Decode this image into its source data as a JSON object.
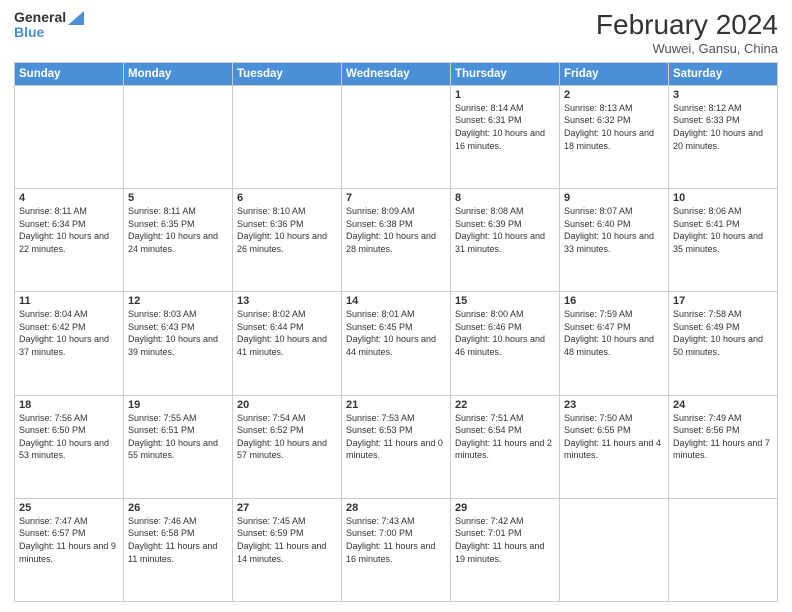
{
  "header": {
    "logo_line1": "General",
    "logo_line2": "Blue",
    "title": "February 2024",
    "subtitle": "Wuwei, Gansu, China"
  },
  "days_of_week": [
    "Sunday",
    "Monday",
    "Tuesday",
    "Wednesday",
    "Thursday",
    "Friday",
    "Saturday"
  ],
  "weeks": [
    [
      {
        "day": "",
        "info": ""
      },
      {
        "day": "",
        "info": ""
      },
      {
        "day": "",
        "info": ""
      },
      {
        "day": "",
        "info": ""
      },
      {
        "day": "1",
        "info": "Sunrise: 8:14 AM\nSunset: 6:31 PM\nDaylight: 10 hours and 16 minutes."
      },
      {
        "day": "2",
        "info": "Sunrise: 8:13 AM\nSunset: 6:32 PM\nDaylight: 10 hours and 18 minutes."
      },
      {
        "day": "3",
        "info": "Sunrise: 8:12 AM\nSunset: 6:33 PM\nDaylight: 10 hours and 20 minutes."
      }
    ],
    [
      {
        "day": "4",
        "info": "Sunrise: 8:11 AM\nSunset: 6:34 PM\nDaylight: 10 hours and 22 minutes."
      },
      {
        "day": "5",
        "info": "Sunrise: 8:11 AM\nSunset: 6:35 PM\nDaylight: 10 hours and 24 minutes."
      },
      {
        "day": "6",
        "info": "Sunrise: 8:10 AM\nSunset: 6:36 PM\nDaylight: 10 hours and 26 minutes."
      },
      {
        "day": "7",
        "info": "Sunrise: 8:09 AM\nSunset: 6:38 PM\nDaylight: 10 hours and 28 minutes."
      },
      {
        "day": "8",
        "info": "Sunrise: 8:08 AM\nSunset: 6:39 PM\nDaylight: 10 hours and 31 minutes."
      },
      {
        "day": "9",
        "info": "Sunrise: 8:07 AM\nSunset: 6:40 PM\nDaylight: 10 hours and 33 minutes."
      },
      {
        "day": "10",
        "info": "Sunrise: 8:06 AM\nSunset: 6:41 PM\nDaylight: 10 hours and 35 minutes."
      }
    ],
    [
      {
        "day": "11",
        "info": "Sunrise: 8:04 AM\nSunset: 6:42 PM\nDaylight: 10 hours and 37 minutes."
      },
      {
        "day": "12",
        "info": "Sunrise: 8:03 AM\nSunset: 6:43 PM\nDaylight: 10 hours and 39 minutes."
      },
      {
        "day": "13",
        "info": "Sunrise: 8:02 AM\nSunset: 6:44 PM\nDaylight: 10 hours and 41 minutes."
      },
      {
        "day": "14",
        "info": "Sunrise: 8:01 AM\nSunset: 6:45 PM\nDaylight: 10 hours and 44 minutes."
      },
      {
        "day": "15",
        "info": "Sunrise: 8:00 AM\nSunset: 6:46 PM\nDaylight: 10 hours and 46 minutes."
      },
      {
        "day": "16",
        "info": "Sunrise: 7:59 AM\nSunset: 6:47 PM\nDaylight: 10 hours and 48 minutes."
      },
      {
        "day": "17",
        "info": "Sunrise: 7:58 AM\nSunset: 6:49 PM\nDaylight: 10 hours and 50 minutes."
      }
    ],
    [
      {
        "day": "18",
        "info": "Sunrise: 7:56 AM\nSunset: 6:50 PM\nDaylight: 10 hours and 53 minutes."
      },
      {
        "day": "19",
        "info": "Sunrise: 7:55 AM\nSunset: 6:51 PM\nDaylight: 10 hours and 55 minutes."
      },
      {
        "day": "20",
        "info": "Sunrise: 7:54 AM\nSunset: 6:52 PM\nDaylight: 10 hours and 57 minutes."
      },
      {
        "day": "21",
        "info": "Sunrise: 7:53 AM\nSunset: 6:53 PM\nDaylight: 11 hours and 0 minutes."
      },
      {
        "day": "22",
        "info": "Sunrise: 7:51 AM\nSunset: 6:54 PM\nDaylight: 11 hours and 2 minutes."
      },
      {
        "day": "23",
        "info": "Sunrise: 7:50 AM\nSunset: 6:55 PM\nDaylight: 11 hours and 4 minutes."
      },
      {
        "day": "24",
        "info": "Sunrise: 7:49 AM\nSunset: 6:56 PM\nDaylight: 11 hours and 7 minutes."
      }
    ],
    [
      {
        "day": "25",
        "info": "Sunrise: 7:47 AM\nSunset: 6:57 PM\nDaylight: 11 hours and 9 minutes."
      },
      {
        "day": "26",
        "info": "Sunrise: 7:46 AM\nSunset: 6:58 PM\nDaylight: 11 hours and 11 minutes."
      },
      {
        "day": "27",
        "info": "Sunrise: 7:45 AM\nSunset: 6:59 PM\nDaylight: 11 hours and 14 minutes."
      },
      {
        "day": "28",
        "info": "Sunrise: 7:43 AM\nSunset: 7:00 PM\nDaylight: 11 hours and 16 minutes."
      },
      {
        "day": "29",
        "info": "Sunrise: 7:42 AM\nSunset: 7:01 PM\nDaylight: 11 hours and 19 minutes."
      },
      {
        "day": "",
        "info": ""
      },
      {
        "day": "",
        "info": ""
      }
    ]
  ]
}
